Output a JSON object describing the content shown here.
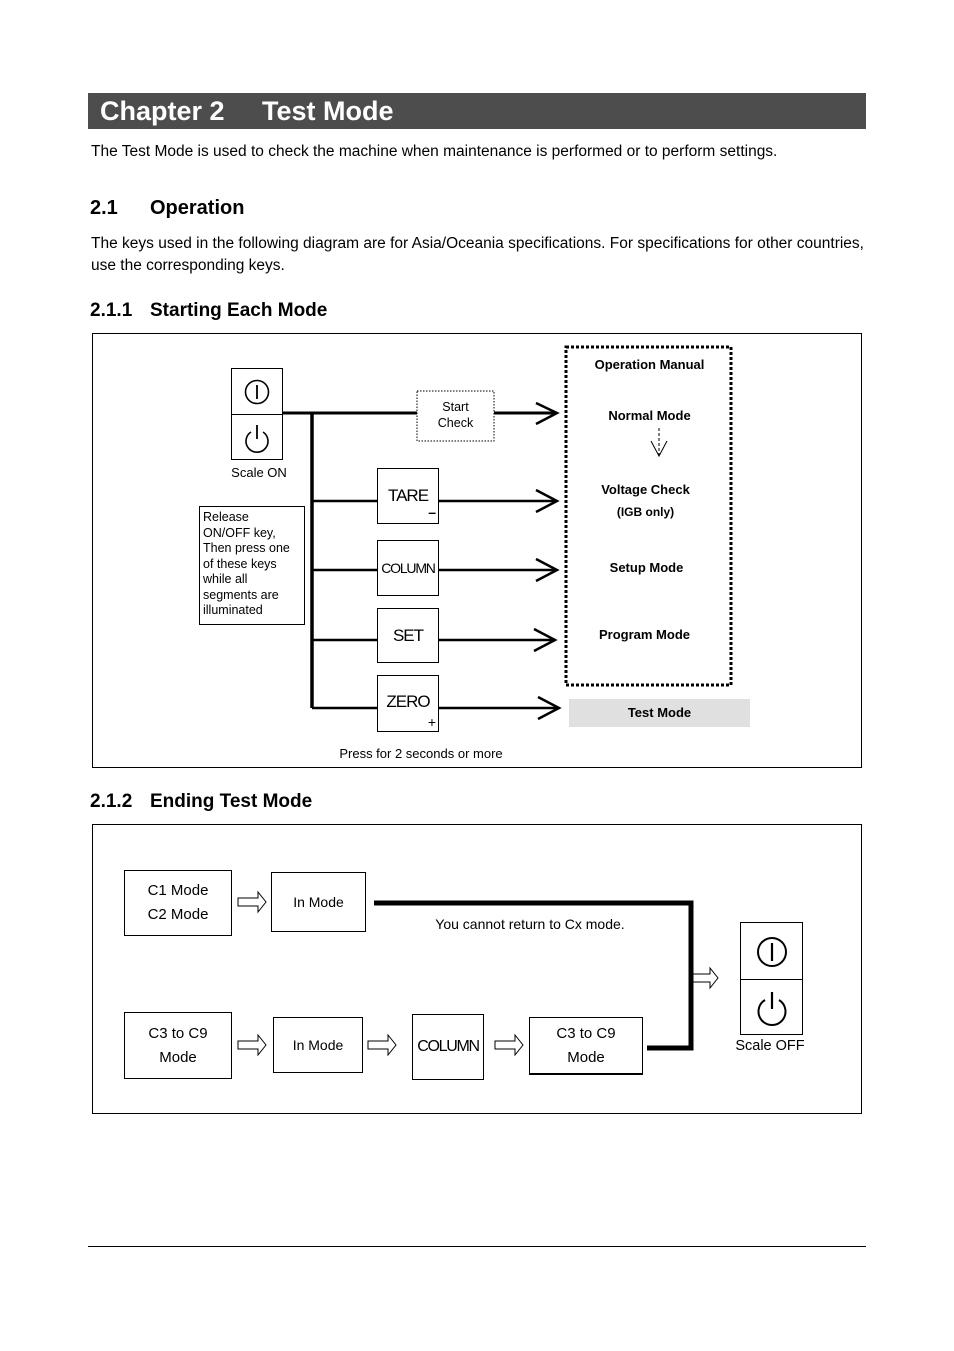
{
  "chapter": {
    "number": "Chapter 2",
    "title": "Test Mode"
  },
  "intro": "The Test Mode is used to check the machine when maintenance is performed or to perform settings.",
  "section_2_1": {
    "number": "2.1",
    "title": "Operation",
    "body": "The keys used in the following diagram are for Asia/Oceania specifications. For specifications for other countries, use the corresponding keys."
  },
  "section_2_1_1": {
    "number": "2.1.1",
    "title": "Starting Each Mode",
    "diagram": {
      "power_key": {
        "on_icon": "power-on-icon",
        "standby_icon": "power-standby-icon",
        "caption": "Scale ON"
      },
      "start_check": [
        "Start",
        "Check"
      ],
      "note": [
        "Release",
        "ON/OFF key,",
        "Then press one",
        "of these keys",
        "while all",
        "segments are",
        "illuminated"
      ],
      "keys": [
        {
          "label": "TARE",
          "sub": "–"
        },
        {
          "label": "COLUMN",
          "sub": ""
        },
        {
          "label": "SET",
          "sub": ""
        },
        {
          "label": "ZERO",
          "sub": "+"
        }
      ],
      "operation_manual_title": "Operation Manual",
      "modes": [
        "Normal Mode",
        "Voltage Check",
        "(IGB only)",
        "Setup Mode",
        "Program Mode"
      ],
      "test_mode": "Test Mode",
      "press_note": "Press for 2 seconds or more"
    }
  },
  "section_2_1_2": {
    "number": "2.1.2",
    "title": "Ending Test Mode",
    "diagram": {
      "row1_start": [
        "C1 Mode",
        "C2 Mode"
      ],
      "row1_in_mode": "In Mode",
      "cannot_return": "You cannot return to Cx mode.",
      "row2_start": [
        "C3 to C9",
        "Mode"
      ],
      "row2_in_mode": "In Mode",
      "column_key": "COLUMN",
      "row2_end": [
        "C3 to C9",
        "Mode"
      ],
      "scale_off": "Scale OFF",
      "power_icons": [
        "power-on-icon",
        "power-standby-icon"
      ]
    }
  }
}
